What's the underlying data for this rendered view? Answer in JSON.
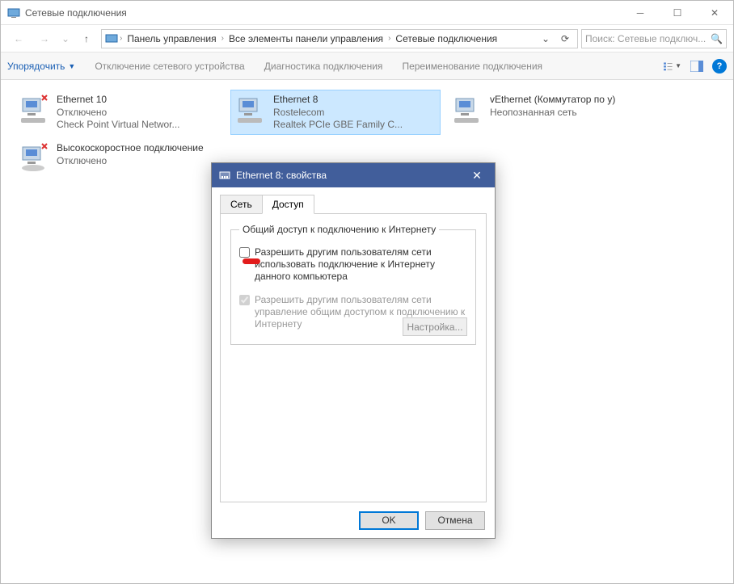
{
  "window": {
    "title": "Сетевые подключения"
  },
  "breadcrumb": {
    "items": [
      "Панель управления",
      "Все элементы панели управления",
      "Сетевые подключения"
    ]
  },
  "search": {
    "placeholder": "Поиск: Сетевые подключ..."
  },
  "toolbar": {
    "organize": "Упорядочить",
    "disable": "Отключение сетевого устройства",
    "diagnose": "Диагностика подключения",
    "rename": "Переименование подключения"
  },
  "connections": [
    {
      "name": "Ethernet 10",
      "status": "Отключено",
      "device": "Check Point Virtual Networ..."
    },
    {
      "name": "Ethernet 8",
      "status": "Rostelecom",
      "device": "Realtek PCIe GBE Family C..."
    },
    {
      "name": "vEthernet (Коммутатор по у)",
      "status": "Неопознанная сеть",
      "device": ""
    },
    {
      "name": "Высокоскоростное подключение",
      "status": "Отключено",
      "device": ""
    }
  ],
  "dialog": {
    "title": "Ethernet 8: свойства",
    "tabs": {
      "network": "Сеть",
      "sharing": "Доступ"
    },
    "group_title": "Общий доступ к подключению к Интернету",
    "opt1": "Разрешить другим пользователям сети использовать подключение к Интернету данного компьютера",
    "opt2": "Разрешить другим пользователям сети управление общим доступом к подключению к Интернету",
    "settings": "Настройка...",
    "ok": "OK",
    "cancel": "Отмена"
  }
}
